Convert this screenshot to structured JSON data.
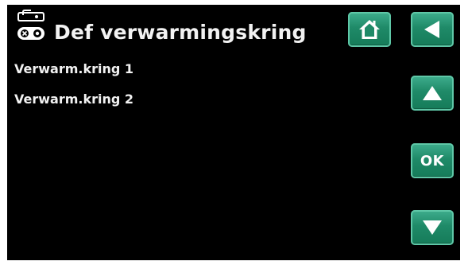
{
  "header": {
    "title": "Def verwarmingskring",
    "icon": "heating-circuit-icon"
  },
  "menu": {
    "items": [
      {
        "label": "Verwarm.kring 1"
      },
      {
        "label": "Verwarm.kring 2"
      }
    ]
  },
  "buttons": {
    "home_icon": "home-icon",
    "back_icon": "back-arrow-icon",
    "up_icon": "arrow-up-icon",
    "ok_label": "OK",
    "down_icon": "arrow-down-icon"
  },
  "colors": {
    "background": "#000000",
    "text": "#f2f2f2",
    "button_green": "#1f8a68"
  }
}
